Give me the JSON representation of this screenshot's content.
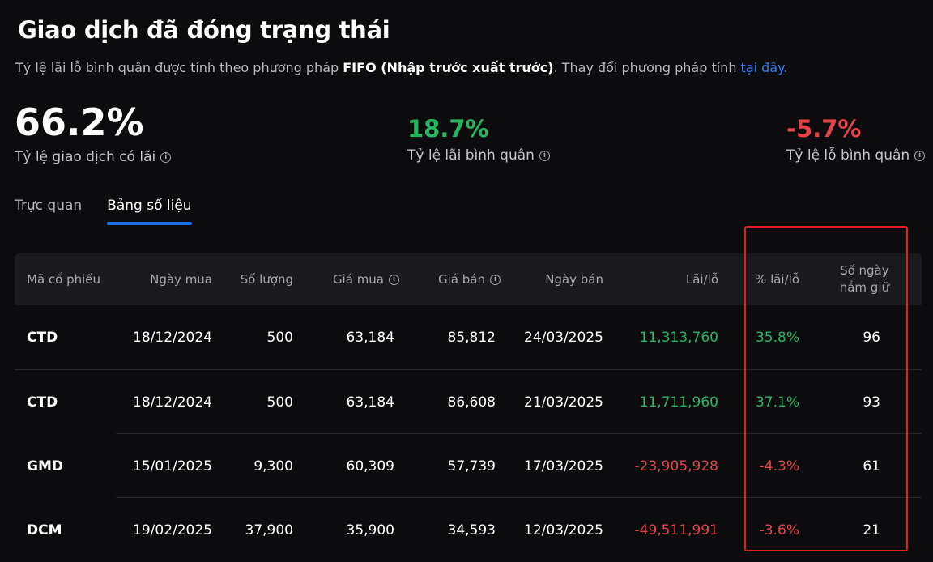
{
  "header": {
    "title": "Giao dịch đã đóng trạng thái",
    "subtitle_prefix": "Tỷ lệ lãi lỗ bình quân được tính theo phương pháp ",
    "subtitle_method": "FIFO (Nhập trước xuất trước)",
    "subtitle_middle": ". Thay đổi phương pháp tính ",
    "subtitle_link": "tại đây."
  },
  "stats": [
    {
      "value": "66.2%",
      "label": "Tỷ lệ giao dịch có lãi",
      "color": "#ffffff"
    },
    {
      "value": "18.7%",
      "label": "Tỷ lệ lãi bình quân",
      "color": "#27b561"
    },
    {
      "value": "-5.7%",
      "label": "Tỷ lệ lỗ bình quân",
      "color": "#e5424a"
    }
  ],
  "info_icon": "ⓘ",
  "tabs": [
    {
      "label": "Trực quan",
      "active": false
    },
    {
      "label": "Bảng số liệu",
      "active": true
    }
  ],
  "table": {
    "columns": {
      "symbol": "Mã cổ phiếu",
      "buy_date": "Ngày mua",
      "quantity": "Số lượng",
      "buy_price": "Giá mua",
      "sell_price": "Giá bán",
      "sell_date": "Ngày bán",
      "pnl": "Lãi/lỗ",
      "pnl_pct": "% lãi/lỗ",
      "holding_days_line1": "Số ngày",
      "holding_days_line2": "nắm giữ"
    },
    "rows": [
      {
        "symbol": "CTD",
        "buy_date": "18/12/2024",
        "quantity": "500",
        "buy_price": "63,184",
        "sell_price": "85,812",
        "sell_date": "24/03/2025",
        "pnl": "11,313,760",
        "pnl_pct": "35.8%",
        "holding_days": "96",
        "direction": "positive"
      },
      {
        "symbol": "CTD",
        "buy_date": "18/12/2024",
        "quantity": "500",
        "buy_price": "63,184",
        "sell_price": "86,608",
        "sell_date": "21/03/2025",
        "pnl": "11,711,960",
        "pnl_pct": "37.1%",
        "holding_days": "93",
        "direction": "positive"
      },
      {
        "symbol": "GMD",
        "buy_date": "15/01/2025",
        "quantity": "9,300",
        "buy_price": "60,309",
        "sell_price": "57,739",
        "sell_date": "17/03/2025",
        "pnl": "-23,905,928",
        "pnl_pct": "-4.3%",
        "holding_days": "61",
        "direction": "negative"
      },
      {
        "symbol": "DCM",
        "buy_date": "19/02/2025",
        "quantity": "37,900",
        "buy_price": "35,900",
        "sell_price": "34,593",
        "sell_date": "12/03/2025",
        "pnl": "-49,511,991",
        "pnl_pct": "-3.6%",
        "holding_days": "21",
        "direction": "negative"
      }
    ]
  },
  "colors": {
    "positive": "#27b561",
    "negative": "#e5424a",
    "accent": "#1f6fe8",
    "link": "#2f7df6",
    "highlight_box": "#e51b1b"
  }
}
